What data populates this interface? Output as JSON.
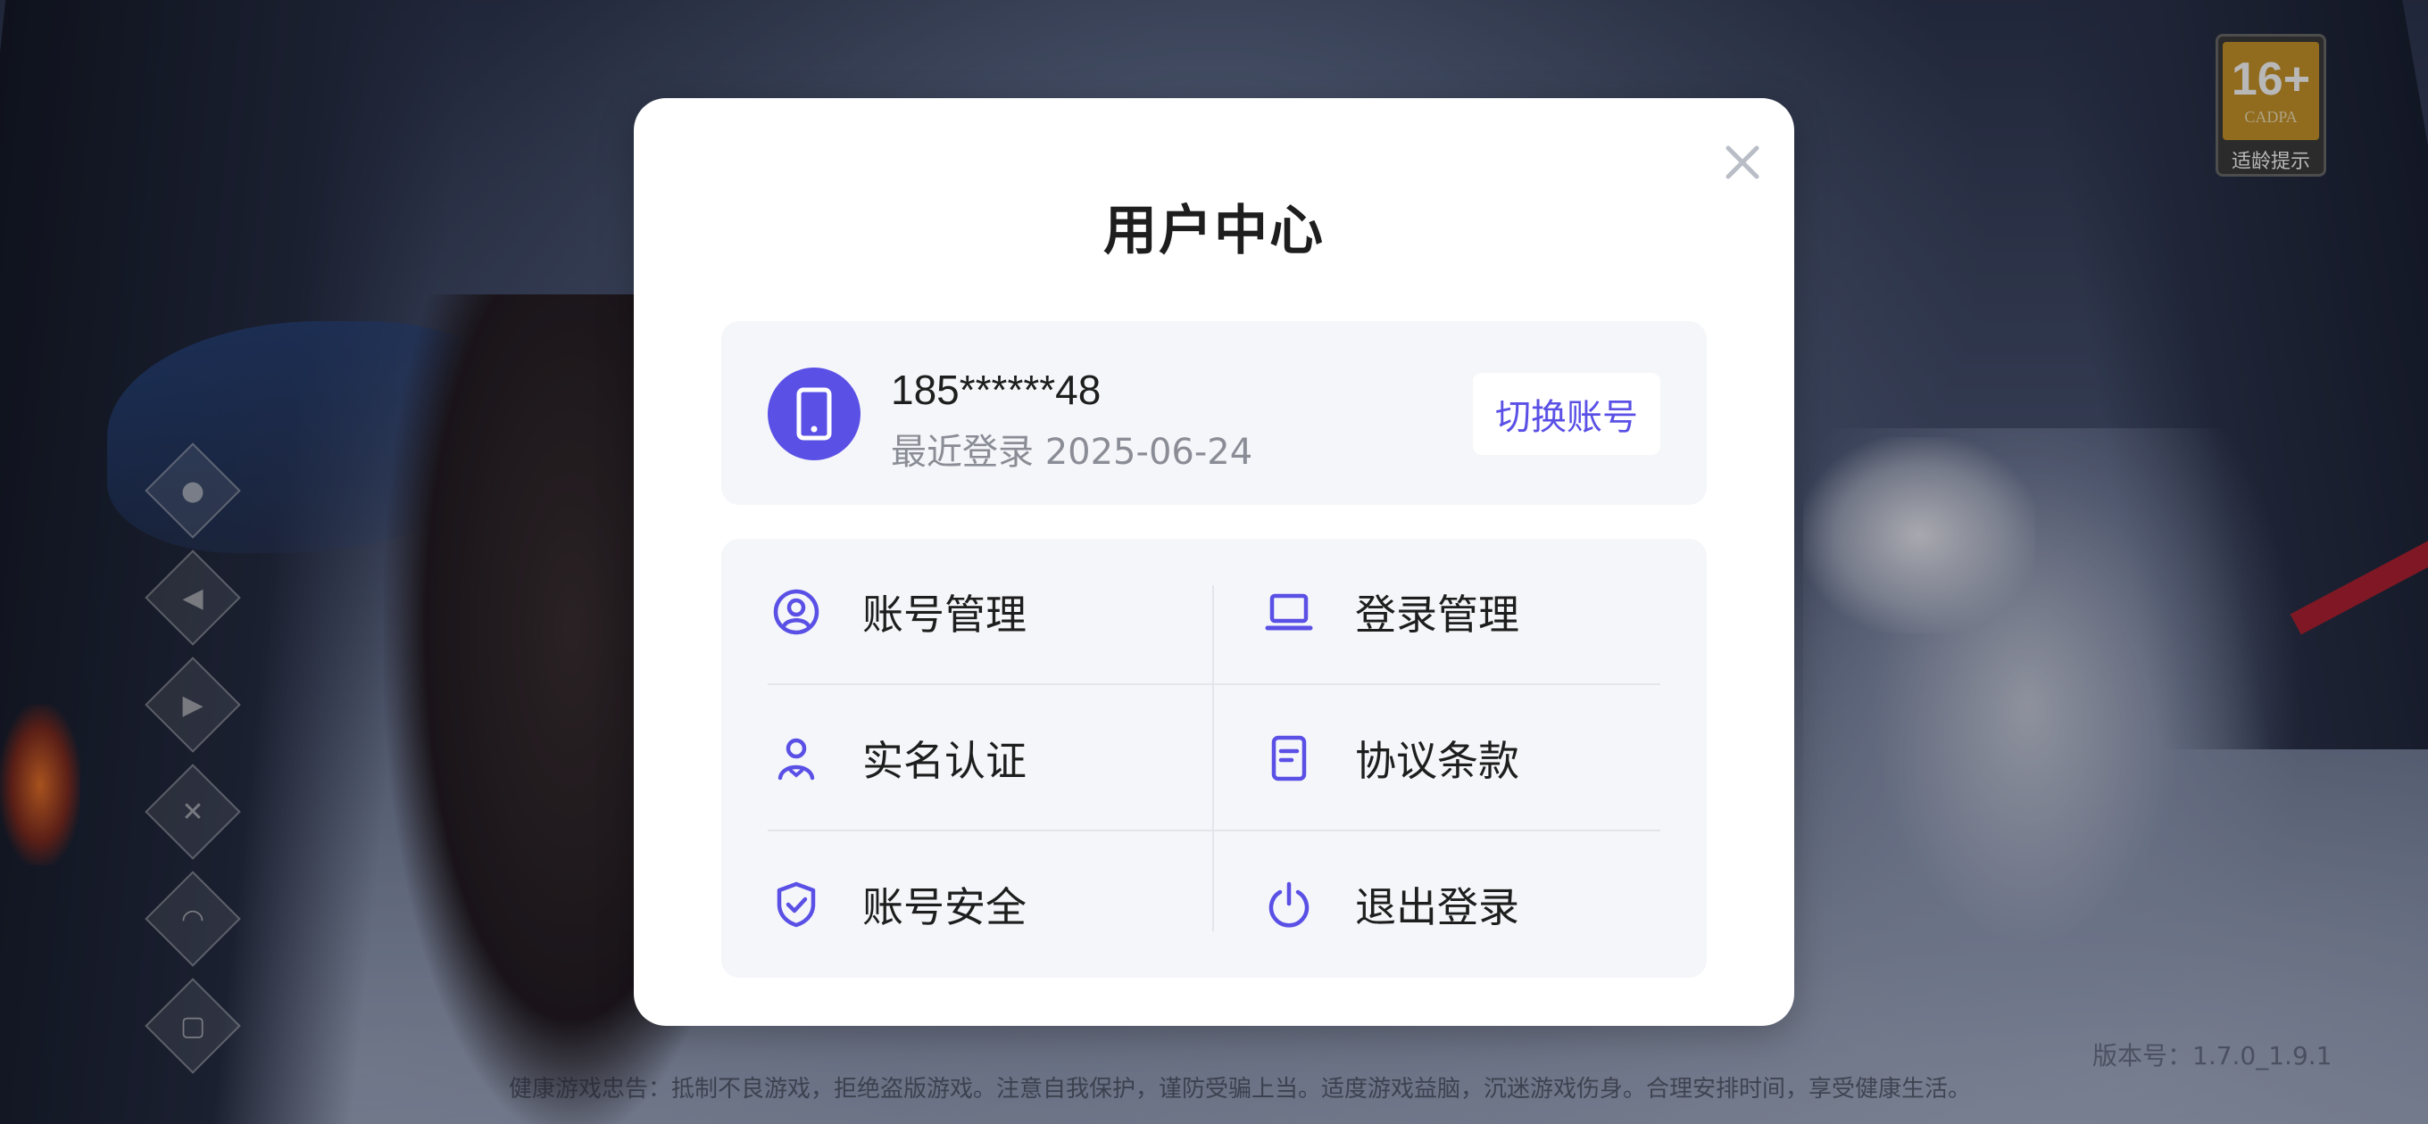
{
  "dialog": {
    "title": "用户中心",
    "close_icon": "close-icon"
  },
  "account": {
    "phone": "185******48",
    "last_login": "最近登录 2025-06-24",
    "switch_label": "切换账号",
    "avatar_icon": "smartphone-icon"
  },
  "menu": {
    "items": [
      {
        "label": "账号管理",
        "icon": "user-circle-icon"
      },
      {
        "label": "登录管理",
        "icon": "laptop-icon"
      },
      {
        "label": "实名认证",
        "icon": "person-icon"
      },
      {
        "label": "协议条款",
        "icon": "document-icon"
      },
      {
        "label": "账号安全",
        "icon": "shield-check-icon"
      },
      {
        "label": "退出登录",
        "icon": "power-icon"
      }
    ]
  },
  "background": {
    "age_rating": "16+",
    "age_org": "CADPA",
    "age_label": "适龄提示",
    "footer_notice": "健康游戏忠告：抵制不良游戏，拒绝盗版游戏。注意自我保护，谨防受骗上当。适度游戏益脑，沉迷游戏伤身。合理安排时间，享受健康生活。",
    "version": "版本号：1.7.0_1.9.1"
  },
  "colors": {
    "accent": "#5a50e6",
    "card_bg": "#f5f6f9",
    "text": "#1e1e1e",
    "subtext": "#8a8d96"
  }
}
